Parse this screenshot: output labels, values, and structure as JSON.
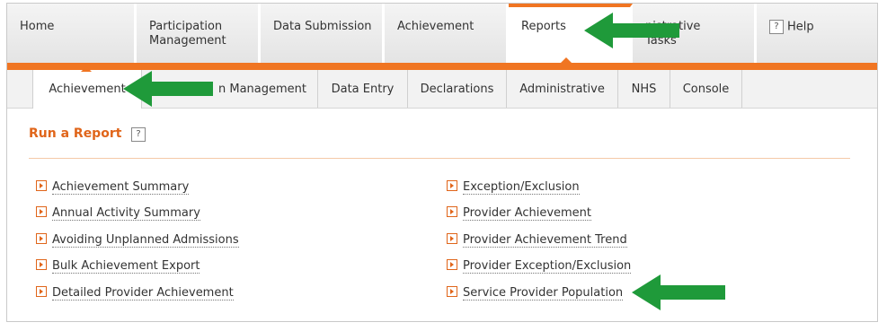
{
  "top_tabs": [
    {
      "label": "Home"
    },
    {
      "label": "Participation\nManagement"
    },
    {
      "label": "Data Submission"
    },
    {
      "label": "Achievement"
    },
    {
      "label": "Reports"
    },
    {
      "label": "nistrative\nTasks"
    },
    {
      "label": "Help"
    }
  ],
  "sub_tabs": [
    {
      "label": "Achievement"
    },
    {
      "label": "n Management"
    },
    {
      "label": "Data Entry"
    },
    {
      "label": "Declarations"
    },
    {
      "label": "Administrative"
    },
    {
      "label": "NHS"
    },
    {
      "label": "Console"
    }
  ],
  "run_report": {
    "title": "Run a Report",
    "help_label": "?"
  },
  "help_glyph": "?",
  "links_left": [
    "Achievement Summary",
    "Annual Activity Summary",
    "Avoiding Unplanned Admissions",
    "Bulk Achievement Export",
    "Detailed Provider Achievement"
  ],
  "links_right": [
    "Exception/Exclusion",
    "Provider Achievement",
    "Provider Achievement Trend",
    "Provider Exception/Exclusion",
    "Service Provider Population"
  ],
  "colors": {
    "accent": "#f07522",
    "highlight_arrow": "#1f9a3a"
  }
}
